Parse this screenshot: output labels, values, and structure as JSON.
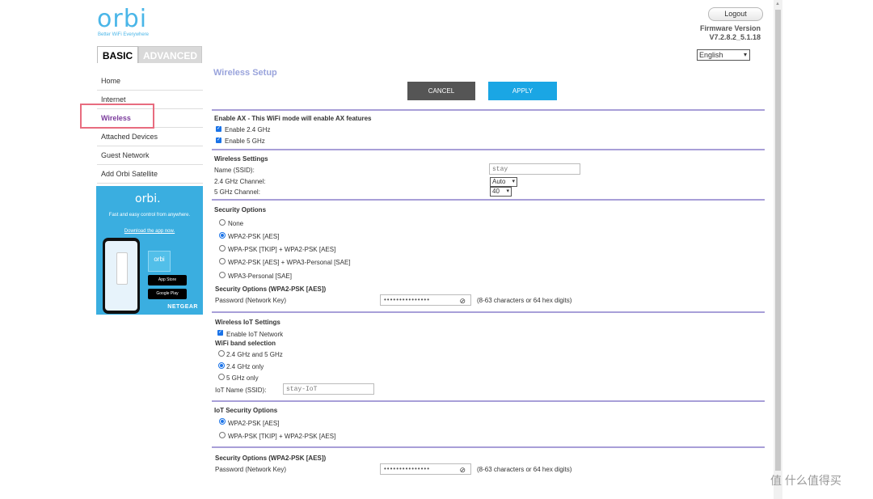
{
  "header": {
    "logo": "orbi",
    "tagline": "Better WiFi Everywhere",
    "logout": "Logout",
    "firmware_label": "Firmware Version",
    "firmware_version": "V7.2.8.2_5.1.18",
    "language": "English"
  },
  "tabs": {
    "basic": "BASIC",
    "advanced": "ADVANCED"
  },
  "sidebar": {
    "items": [
      {
        "label": "Home"
      },
      {
        "label": "Internet"
      },
      {
        "label": "Wireless"
      },
      {
        "label": "Attached Devices"
      },
      {
        "label": "Guest Network"
      },
      {
        "label": "Add Orbi Satellite"
      }
    ]
  },
  "promo": {
    "logo": "orbi.",
    "text": "Fast and easy control from anywhere.",
    "link": "Download the app now.",
    "tile": "orbi",
    "app_store": "App Store",
    "google_play": "Google Play",
    "brand": "NETGEAR"
  },
  "main": {
    "title": "Wireless Setup",
    "cancel": "CANCEL",
    "apply": "APPLY",
    "ax": {
      "heading": "Enable AX - This WiFi mode will enable AX features",
      "enable24": "Enable 2.4 GHz",
      "enable5": "Enable 5 GHz"
    },
    "wireless": {
      "heading": "Wireless Settings",
      "ssid_label": "Name (SSID):",
      "ssid_value": "stay",
      "ch24_label": "2.4 GHz Channel:",
      "ch24_value": "Auto",
      "ch5_label": "5 GHz Channel:",
      "ch5_value": "40"
    },
    "security": {
      "heading": "Security Options",
      "options": [
        "None",
        "WPA2-PSK [AES]",
        "WPA-PSK [TKIP] + WPA2-PSK [AES]",
        "WPA2-PSK [AES] + WPA3-Personal [SAE]",
        "WPA3-Personal [SAE]"
      ],
      "sub_heading": "Security Options (WPA2-PSK [AES])",
      "pw_label": "Password (Network Key)",
      "pw_mask": "•••••••••••••••",
      "pw_hint": "(8-63 characters or 64 hex digits)"
    },
    "iot": {
      "heading": "Wireless IoT Settings",
      "enable": "Enable IoT Network",
      "band_heading": "WiFi band selection",
      "bands": [
        "2.4 GHz and 5 GHz",
        "2.4 GHz only",
        "5 GHz only"
      ],
      "name_label": "IoT Name (SSID):",
      "name_value": "stay-IoT"
    },
    "iot_security": {
      "heading": "IoT Security Options",
      "options": [
        "WPA2-PSK [AES]",
        "WPA-PSK [TKIP] + WPA2-PSK [AES]"
      ],
      "sub_heading": "Security Options (WPA2-PSK [AES])",
      "pw_label": "Password (Network Key)",
      "pw_mask": "•••••••••••••••",
      "pw_hint": "(8-63 characters or 64 hex digits)"
    }
  },
  "watermark": "值 什么值得买"
}
